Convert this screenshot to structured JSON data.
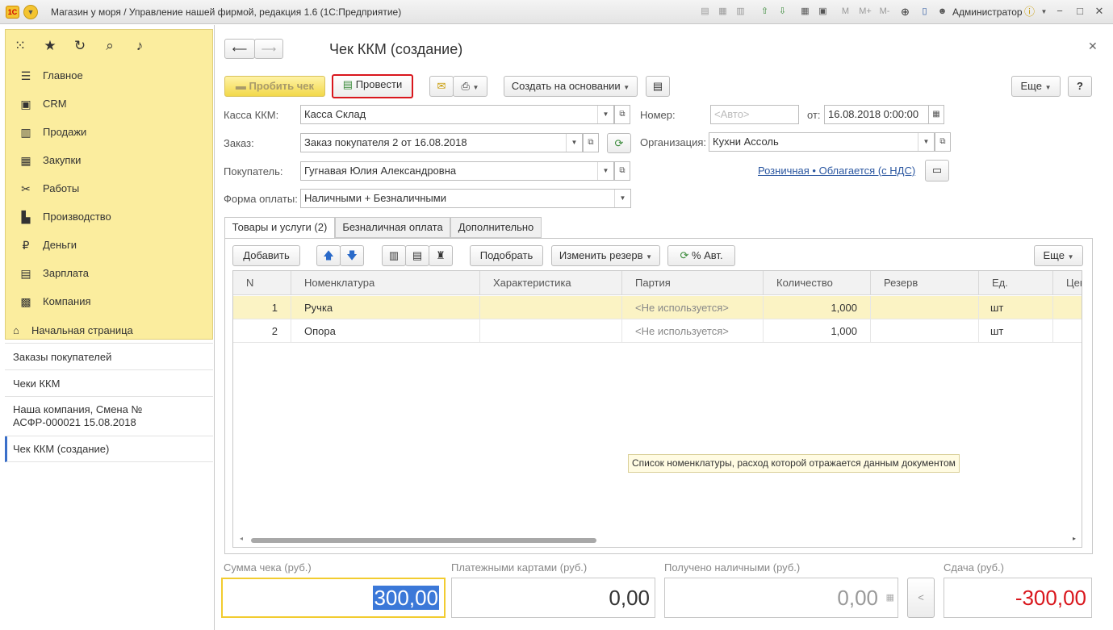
{
  "window": {
    "title": "Магазин у моря / Управление нашей фирмой, редакция 1.6  (1С:Предприятие)",
    "user": "Администратор",
    "logo_text": "1С"
  },
  "sections": [
    {
      "label": "Главное",
      "icon": "menu-lines-icon"
    },
    {
      "label": "CRM",
      "icon": "crm-icon"
    },
    {
      "label": "Продажи",
      "icon": "shopping-cart-icon"
    },
    {
      "label": "Закупки",
      "icon": "purchase-icon"
    },
    {
      "label": "Работы",
      "icon": "tools-icon"
    },
    {
      "label": "Производство",
      "icon": "factory-icon"
    },
    {
      "label": "Деньги",
      "icon": "money-icon"
    },
    {
      "label": "Зарплата",
      "icon": "salary-icon"
    },
    {
      "label": "Компания",
      "icon": "company-icon"
    }
  ],
  "open_windows": [
    {
      "label": "Начальная страница"
    },
    {
      "label": "Заказы покупателей"
    },
    {
      "label": "Чеки ККМ"
    },
    {
      "label": "Наша компания, Смена №",
      "label2": "АСФР-000021  15.08.2018"
    },
    {
      "label": "Чек ККМ (создание)"
    }
  ],
  "form": {
    "title": "Чек ККМ (создание)",
    "buttons": {
      "print_check": "Пробить чек",
      "post": "Провести",
      "create_based": "Создать на основании",
      "more": "Еще",
      "help": "?"
    },
    "fields": {
      "kassa_label": "Касса ККМ:",
      "kassa_value": "Касса Склад",
      "order_label": "Заказ:",
      "order_value": "Заказ покупателя 2 от 16.08.2018",
      "buyer_label": "Покупатель:",
      "buyer_value": "Гугнавая Юлия Александровна",
      "payform_label": "Форма оплаты:",
      "payform_value": "Наличными + Безналичными",
      "number_label": "Номер:",
      "number_placeholder": "<Авто>",
      "from_label": "от:",
      "date_value": "16.08.2018  0:00:00",
      "org_label": "Организация:",
      "org_value": "Кухни Ассоль",
      "tax_link": "Розничная • Облагается (с НДС)"
    },
    "tabs": [
      "Товары и услуги (2)",
      "Безналичная оплата",
      "Дополнительно"
    ],
    "table_toolbar": {
      "add": "Добавить",
      "select": "Подобрать",
      "change_reserve": "Изменить резерв",
      "auto_percent": "% Авт.",
      "more": "Еще"
    },
    "table": {
      "columns": [
        "N",
        "Номенклатура",
        "Характеристика",
        "Партия",
        "Количество",
        "Резерв",
        "Ед.",
        "Цен"
      ],
      "rows": [
        {
          "n": "1",
          "item": "Ручка",
          "char": "",
          "batch": "<Не используется>",
          "qty": "1,000",
          "reserve": "",
          "unit": "шт"
        },
        {
          "n": "2",
          "item": "Опора",
          "char": "",
          "batch": "<Не используется>",
          "qty": "1,000",
          "reserve": "",
          "unit": "шт"
        }
      ]
    },
    "tooltip": "Список номенклатуры, расход которой отражается данным документом",
    "totals": {
      "sum_label": "Сумма чека (руб.)",
      "sum_value": "300,00",
      "cards_label": "Платежными картами (руб.)",
      "cards_value": "0,00",
      "cash_label": "Получено наличными (руб.)",
      "cash_value": "0,00",
      "change_label": "Сдача (руб.)",
      "change_value": "-300,00",
      "change_color": "#d9161c"
    }
  }
}
